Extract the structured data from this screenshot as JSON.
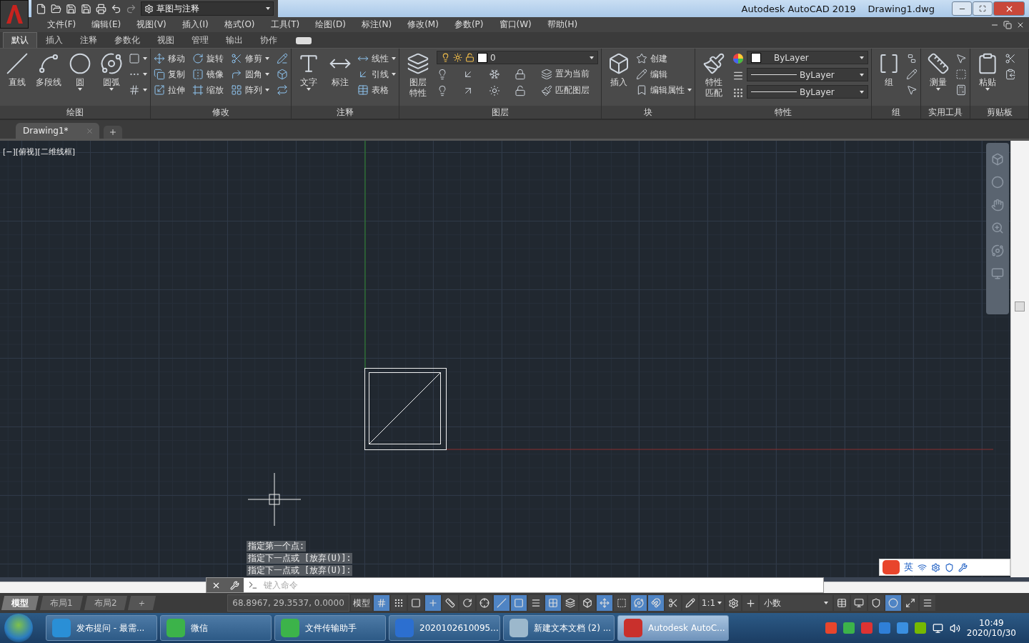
{
  "title_bar": {
    "workspace": "草图与注释",
    "title": "Autodesk AutoCAD 2019",
    "file": "Drawing1.dwg"
  },
  "menu": [
    "文件(F)",
    "编辑(E)",
    "视图(V)",
    "插入(I)",
    "格式(O)",
    "工具(T)",
    "绘图(D)",
    "标注(N)",
    "修改(M)",
    "参数(P)",
    "窗口(W)",
    "帮助(H)"
  ],
  "ribbon_tabs": [
    {
      "label": "默认",
      "selected": true
    },
    {
      "label": "插入",
      "selected": false
    },
    {
      "label": "注释",
      "selected": false
    },
    {
      "label": "参数化",
      "selected": false
    },
    {
      "label": "视图",
      "selected": false
    },
    {
      "label": "管理",
      "selected": false
    },
    {
      "label": "输出",
      "selected": false
    },
    {
      "label": "协作",
      "selected": false
    }
  ],
  "panels": [
    {
      "title": "绘图",
      "sections": [
        {
          "kind": "large",
          "items": [
            {
              "label": "直线",
              "dropdown": false
            },
            {
              "label": "多段线",
              "dropdown": false
            },
            {
              "label": "圆",
              "dropdown": true
            },
            {
              "label": "圆弧",
              "dropdown": true
            }
          ]
        },
        {
          "kind": "stack",
          "items": [
            {
              "dropdown": true
            },
            {
              "dropdown": true
            },
            {
              "dropdown": true
            }
          ]
        }
      ]
    },
    {
      "title": "修改",
      "sections": [
        {
          "kind": "stack",
          "items": [
            {
              "label": "移动",
              "dropdown": false
            },
            {
              "label": "复制",
              "dropdown": false
            },
            {
              "label": "拉伸",
              "dropdown": false
            },
            {
              "label": "旋转",
              "dropdown": false
            },
            {
              "label": "镜像",
              "dropdown": false
            },
            {
              "label": "缩放",
              "dropdown": false
            },
            {
              "label": "修剪",
              "dropdown": true
            },
            {
              "label": "圆角",
              "dropdown": true
            },
            {
              "label": "阵列",
              "dropdown": true
            },
            {
              "dropdown": false
            },
            {
              "dropdown": false
            },
            {
              "dropdown": false
            }
          ]
        }
      ]
    },
    {
      "title": "注释",
      "sections": [
        {
          "kind": "large",
          "items": [
            {
              "label": "文字",
              "dropdown": true
            },
            {
              "label": "标注",
              "dropdown": false
            }
          ]
        },
        {
          "kind": "stack",
          "items": [
            {
              "label": "线性",
              "dropdown": true
            },
            {
              "label": "引线",
              "dropdown": true
            },
            {
              "label": "表格",
              "dropdown": false
            }
          ]
        }
      ]
    },
    {
      "title": "图层",
      "sections": [
        {
          "kind": "large",
          "items": [
            {
              "label": "图层特性",
              "dropdown": false
            }
          ]
        },
        {
          "kind": "layer",
          "value": "0",
          "labels": [
            "置为当前",
            "匹配图层"
          ]
        }
      ]
    },
    {
      "title": "块",
      "sections": [
        {
          "kind": "large",
          "items": [
            {
              "label": "插入",
              "dropdown": false
            }
          ]
        },
        {
          "kind": "stack",
          "items": [
            {
              "label": "创建",
              "dropdown": false
            },
            {
              "label": "编辑",
              "dropdown": false
            },
            {
              "label": "编辑属性",
              "dropdown": true
            }
          ]
        }
      ]
    },
    {
      "title": "特性",
      "sections": [
        {
          "kind": "large",
          "items": [
            {
              "label": "特性匹配",
              "dropdown": false
            }
          ]
        },
        {
          "kind": "props",
          "values": [
            "ByLayer",
            "ByLayer",
            "ByLayer"
          ]
        }
      ]
    },
    {
      "title": "组",
      "sections": [
        {
          "kind": "large",
          "items": [
            {
              "label": "组",
              "dropdown": false
            }
          ]
        },
        {
          "kind": "stack",
          "items": [
            {
              "dropdown": false
            },
            {
              "dropdown": false
            },
            {
              "dropdown": false
            }
          ]
        }
      ]
    },
    {
      "title": "实用工具",
      "sections": [
        {
          "kind": "large",
          "items": [
            {
              "label": "测量",
              "dropdown": true
            }
          ]
        },
        {
          "kind": "stack",
          "items": [
            {
              "dropdown": false
            },
            {
              "dropdown": false
            },
            {
              "dropdown": false
            }
          ]
        }
      ]
    },
    {
      "title": "剪贴板",
      "sections": [
        {
          "kind": "large",
          "items": [
            {
              "label": "粘贴",
              "dropdown": true
            }
          ]
        },
        {
          "kind": "stack",
          "items": [
            {
              "dropdown": false
            },
            {
              "dropdown": false
            }
          ]
        }
      ]
    }
  ],
  "document_tabs": [
    {
      "label": "Drawing1*",
      "selected": true
    }
  ],
  "viewport_label": "[−][俯视][二维线框]",
  "command_history": [
    "指定第一个点:",
    "指定下一点或 [放弃(U)]:",
    "指定下一点或 [放弃(U)]:"
  ],
  "command_line": {
    "placeholder": "键入命令"
  },
  "ime": {
    "mode": "英"
  },
  "layout_tabs": [
    {
      "label": "模型",
      "selected": true
    },
    {
      "label": "布局1",
      "selected": false
    },
    {
      "label": "布局2",
      "selected": false
    }
  ],
  "status_bar": {
    "coordinates": "68.8967, 29.3537, 0.0000",
    "space": "模型",
    "scale": "1:1",
    "units": "小数"
  },
  "status_toggles": [
    {
      "on": true
    },
    {
      "on": false
    },
    {
      "on": false
    },
    {
      "on": true
    },
    {
      "on": false
    },
    {
      "on": false
    },
    {
      "on": false
    },
    {
      "on": true
    },
    {
      "on": true
    },
    {
      "on": false
    },
    {
      "on": true
    },
    {
      "on": false
    },
    {
      "on": false
    },
    {
      "on": true
    },
    {
      "on": false
    },
    {
      "on": true
    },
    {
      "on": true
    },
    {
      "on": false
    },
    {
      "on": false
    }
  ],
  "status_tools": [
    {
      "on": false
    },
    {
      "on": false
    },
    {
      "on": false
    },
    {
      "on": true
    },
    {
      "on": false
    },
    {
      "on": false
    }
  ],
  "taskbar": {
    "items": [
      {
        "label": "发布提问 - 最需...",
        "selected": false
      },
      {
        "label": "微信",
        "selected": false
      },
      {
        "label": "文件传输助手",
        "selected": false
      },
      {
        "label": "2020102610095...",
        "selected": false
      },
      {
        "label": "新建文本文档 (2) ...",
        "selected": false
      },
      {
        "label": "Autodesk AutoC...",
        "selected": true
      }
    ],
    "time": "10:49",
    "date": "2020/10/30"
  }
}
